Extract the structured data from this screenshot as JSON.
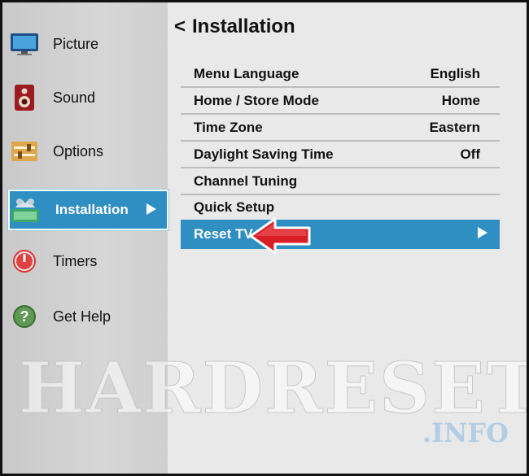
{
  "sidebar": {
    "items": [
      {
        "label": "Picture",
        "icon": "tv-icon"
      },
      {
        "label": "Sound",
        "icon": "speaker-icon"
      },
      {
        "label": "Options",
        "icon": "options-sliders-icon"
      },
      {
        "label": "Installation",
        "icon": "installation-icon",
        "selected": true
      },
      {
        "label": "Timers",
        "icon": "timer-icon"
      },
      {
        "label": "Get Help",
        "icon": "help-icon"
      }
    ]
  },
  "main": {
    "back_symbol": "<",
    "title": "Installation",
    "rows": [
      {
        "label": "Menu Language",
        "value": "English"
      },
      {
        "label": "Home / Store Mode",
        "value": "Home"
      },
      {
        "label": "Time Zone",
        "value": "Eastern"
      },
      {
        "label": "Daylight Saving Time",
        "value": "Off"
      },
      {
        "label": "Channel Tuning",
        "value": ""
      },
      {
        "label": "Quick Setup",
        "value": ""
      },
      {
        "label": "Reset TV",
        "value": "",
        "selected": true
      }
    ]
  },
  "watermark": {
    "main": "HARDRESET",
    "sub": ".INFO"
  },
  "colors": {
    "selection": "#2f8fc2",
    "arrow": "#d81f26"
  }
}
